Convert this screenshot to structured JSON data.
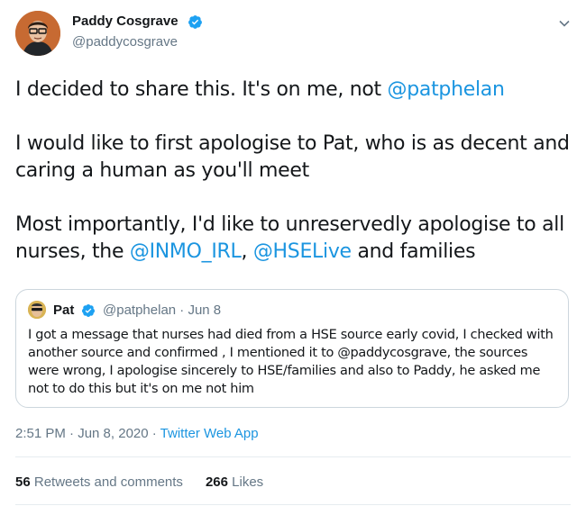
{
  "author": {
    "name": "Paddy Cosgrave",
    "handle": "@paddycosgrave"
  },
  "tweet": {
    "line1_prefix": "I decided to share this. It's on me, not ",
    "mention_patphelan": "@patphelan",
    "paragraph2": "I would like to first apologise to Pat, who is as decent and caring a human as you'll meet",
    "line3_prefix": "Most importantly, I'd like to unreservedly apologise to all nurses, the ",
    "mention_inmo": "@INMO_IRL",
    "sep": ", ",
    "mention_hse": "@HSELive",
    "line3_suffix": " and families"
  },
  "quoted": {
    "name": "Pat",
    "handle_date": "@patphelan · Jun 8",
    "text": "I got a message that nurses had died from a HSE source early covid, I checked with another source and confirmed , I mentioned it to @paddycosgrave, the sources were wrong, I apologise sincerely to HSE/families and also to Paddy, he asked me not to do this but it's on me not him"
  },
  "meta": {
    "timestamp": "2:51 PM · Jun 8, 2020 · ",
    "app": "Twitter Web App"
  },
  "stats": {
    "retweets_count": "56",
    "retweets_label": " Retweets and comments",
    "likes_count": "266",
    "likes_label": " Likes"
  },
  "colors": {
    "link": "#1b95e0",
    "secondary": "#657786",
    "border": "#ccd6dd"
  },
  "icons": [
    "verified-badge-icon",
    "chevron-down-icon"
  ]
}
